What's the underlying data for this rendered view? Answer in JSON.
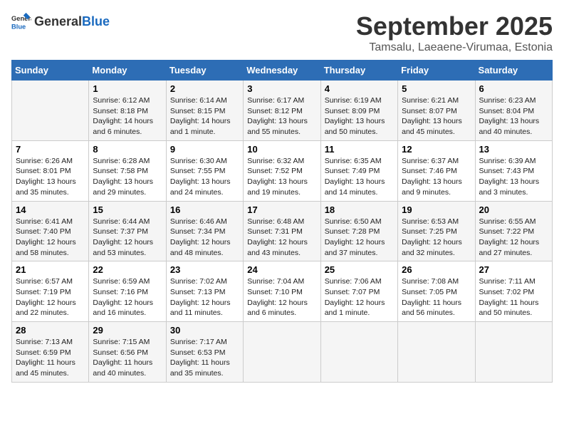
{
  "logo": {
    "general": "General",
    "blue": "Blue"
  },
  "header": {
    "month": "September 2025",
    "location": "Tamsalu, Laeaene-Virumaa, Estonia"
  },
  "weekdays": [
    "Sunday",
    "Monday",
    "Tuesday",
    "Wednesday",
    "Thursday",
    "Friday",
    "Saturday"
  ],
  "weeks": [
    [
      {
        "day": "",
        "sunrise": "",
        "sunset": "",
        "daylight": ""
      },
      {
        "day": "1",
        "sunrise": "Sunrise: 6:12 AM",
        "sunset": "Sunset: 8:18 PM",
        "daylight": "Daylight: 14 hours and 6 minutes."
      },
      {
        "day": "2",
        "sunrise": "Sunrise: 6:14 AM",
        "sunset": "Sunset: 8:15 PM",
        "daylight": "Daylight: 14 hours and 1 minute."
      },
      {
        "day": "3",
        "sunrise": "Sunrise: 6:17 AM",
        "sunset": "Sunset: 8:12 PM",
        "daylight": "Daylight: 13 hours and 55 minutes."
      },
      {
        "day": "4",
        "sunrise": "Sunrise: 6:19 AM",
        "sunset": "Sunset: 8:09 PM",
        "daylight": "Daylight: 13 hours and 50 minutes."
      },
      {
        "day": "5",
        "sunrise": "Sunrise: 6:21 AM",
        "sunset": "Sunset: 8:07 PM",
        "daylight": "Daylight: 13 hours and 45 minutes."
      },
      {
        "day": "6",
        "sunrise": "Sunrise: 6:23 AM",
        "sunset": "Sunset: 8:04 PM",
        "daylight": "Daylight: 13 hours and 40 minutes."
      }
    ],
    [
      {
        "day": "7",
        "sunrise": "Sunrise: 6:26 AM",
        "sunset": "Sunset: 8:01 PM",
        "daylight": "Daylight: 13 hours and 35 minutes."
      },
      {
        "day": "8",
        "sunrise": "Sunrise: 6:28 AM",
        "sunset": "Sunset: 7:58 PM",
        "daylight": "Daylight: 13 hours and 29 minutes."
      },
      {
        "day": "9",
        "sunrise": "Sunrise: 6:30 AM",
        "sunset": "Sunset: 7:55 PM",
        "daylight": "Daylight: 13 hours and 24 minutes."
      },
      {
        "day": "10",
        "sunrise": "Sunrise: 6:32 AM",
        "sunset": "Sunset: 7:52 PM",
        "daylight": "Daylight: 13 hours and 19 minutes."
      },
      {
        "day": "11",
        "sunrise": "Sunrise: 6:35 AM",
        "sunset": "Sunset: 7:49 PM",
        "daylight": "Daylight: 13 hours and 14 minutes."
      },
      {
        "day": "12",
        "sunrise": "Sunrise: 6:37 AM",
        "sunset": "Sunset: 7:46 PM",
        "daylight": "Daylight: 13 hours and 9 minutes."
      },
      {
        "day": "13",
        "sunrise": "Sunrise: 6:39 AM",
        "sunset": "Sunset: 7:43 PM",
        "daylight": "Daylight: 13 hours and 3 minutes."
      }
    ],
    [
      {
        "day": "14",
        "sunrise": "Sunrise: 6:41 AM",
        "sunset": "Sunset: 7:40 PM",
        "daylight": "Daylight: 12 hours and 58 minutes."
      },
      {
        "day": "15",
        "sunrise": "Sunrise: 6:44 AM",
        "sunset": "Sunset: 7:37 PM",
        "daylight": "Daylight: 12 hours and 53 minutes."
      },
      {
        "day": "16",
        "sunrise": "Sunrise: 6:46 AM",
        "sunset": "Sunset: 7:34 PM",
        "daylight": "Daylight: 12 hours and 48 minutes."
      },
      {
        "day": "17",
        "sunrise": "Sunrise: 6:48 AM",
        "sunset": "Sunset: 7:31 PM",
        "daylight": "Daylight: 12 hours and 43 minutes."
      },
      {
        "day": "18",
        "sunrise": "Sunrise: 6:50 AM",
        "sunset": "Sunset: 7:28 PM",
        "daylight": "Daylight: 12 hours and 37 minutes."
      },
      {
        "day": "19",
        "sunrise": "Sunrise: 6:53 AM",
        "sunset": "Sunset: 7:25 PM",
        "daylight": "Daylight: 12 hours and 32 minutes."
      },
      {
        "day": "20",
        "sunrise": "Sunrise: 6:55 AM",
        "sunset": "Sunset: 7:22 PM",
        "daylight": "Daylight: 12 hours and 27 minutes."
      }
    ],
    [
      {
        "day": "21",
        "sunrise": "Sunrise: 6:57 AM",
        "sunset": "Sunset: 7:19 PM",
        "daylight": "Daylight: 12 hours and 22 minutes."
      },
      {
        "day": "22",
        "sunrise": "Sunrise: 6:59 AM",
        "sunset": "Sunset: 7:16 PM",
        "daylight": "Daylight: 12 hours and 16 minutes."
      },
      {
        "day": "23",
        "sunrise": "Sunrise: 7:02 AM",
        "sunset": "Sunset: 7:13 PM",
        "daylight": "Daylight: 12 hours and 11 minutes."
      },
      {
        "day": "24",
        "sunrise": "Sunrise: 7:04 AM",
        "sunset": "Sunset: 7:10 PM",
        "daylight": "Daylight: 12 hours and 6 minutes."
      },
      {
        "day": "25",
        "sunrise": "Sunrise: 7:06 AM",
        "sunset": "Sunset: 7:07 PM",
        "daylight": "Daylight: 12 hours and 1 minute."
      },
      {
        "day": "26",
        "sunrise": "Sunrise: 7:08 AM",
        "sunset": "Sunset: 7:05 PM",
        "daylight": "Daylight: 11 hours and 56 minutes."
      },
      {
        "day": "27",
        "sunrise": "Sunrise: 7:11 AM",
        "sunset": "Sunset: 7:02 PM",
        "daylight": "Daylight: 11 hours and 50 minutes."
      }
    ],
    [
      {
        "day": "28",
        "sunrise": "Sunrise: 7:13 AM",
        "sunset": "Sunset: 6:59 PM",
        "daylight": "Daylight: 11 hours and 45 minutes."
      },
      {
        "day": "29",
        "sunrise": "Sunrise: 7:15 AM",
        "sunset": "Sunset: 6:56 PM",
        "daylight": "Daylight: 11 hours and 40 minutes."
      },
      {
        "day": "30",
        "sunrise": "Sunrise: 7:17 AM",
        "sunset": "Sunset: 6:53 PM",
        "daylight": "Daylight: 11 hours and 35 minutes."
      },
      {
        "day": "",
        "sunrise": "",
        "sunset": "",
        "daylight": ""
      },
      {
        "day": "",
        "sunrise": "",
        "sunset": "",
        "daylight": ""
      },
      {
        "day": "",
        "sunrise": "",
        "sunset": "",
        "daylight": ""
      },
      {
        "day": "",
        "sunrise": "",
        "sunset": "",
        "daylight": ""
      }
    ]
  ]
}
